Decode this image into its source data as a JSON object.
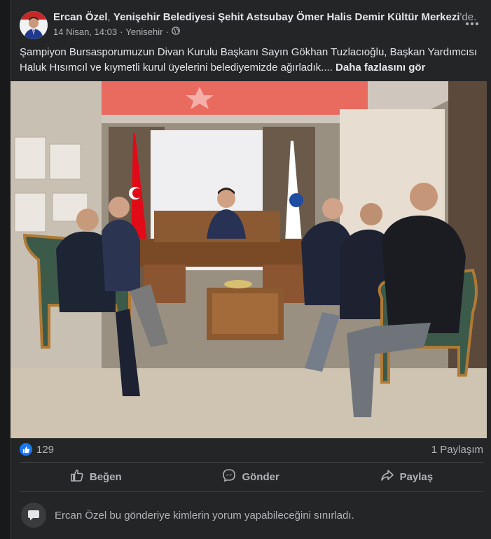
{
  "post": {
    "author": "Ercan Özel",
    "separator": ", ",
    "place": "Yenişehir Belediyesi Şehit Astsubay Ömer Halis Demir Kültür Merkezi",
    "place_suffix": "'de.",
    "date": "14 Nisan, 14:03",
    "dot": "·",
    "location": "Yenisehir",
    "dot2": "·",
    "privacy_icon": "globe-icon",
    "text": "Şampiyon Bursasporumuzun Divan Kurulu Başkanı Sayın Gökhan Tuzlacıoğlu, Başkan Yardımcısı Haluk Hısımcıl ve kıymetli kurul üyelerini belediyemizde ağırladık....",
    "see_more": "Daha fazlasını gör"
  },
  "photo": {
    "flag_color": "#e30a17",
    "ceiling_color": "#ee6a62"
  },
  "stats": {
    "like_count": "129",
    "share_count": "1 Paylaşım"
  },
  "actions": {
    "like": "Beğen",
    "send": "Gönder",
    "share": "Paylaş"
  },
  "comment_notice": "Ercan Özel bu gönderiye kimlerin yorum yapabileceğini sınırladı."
}
